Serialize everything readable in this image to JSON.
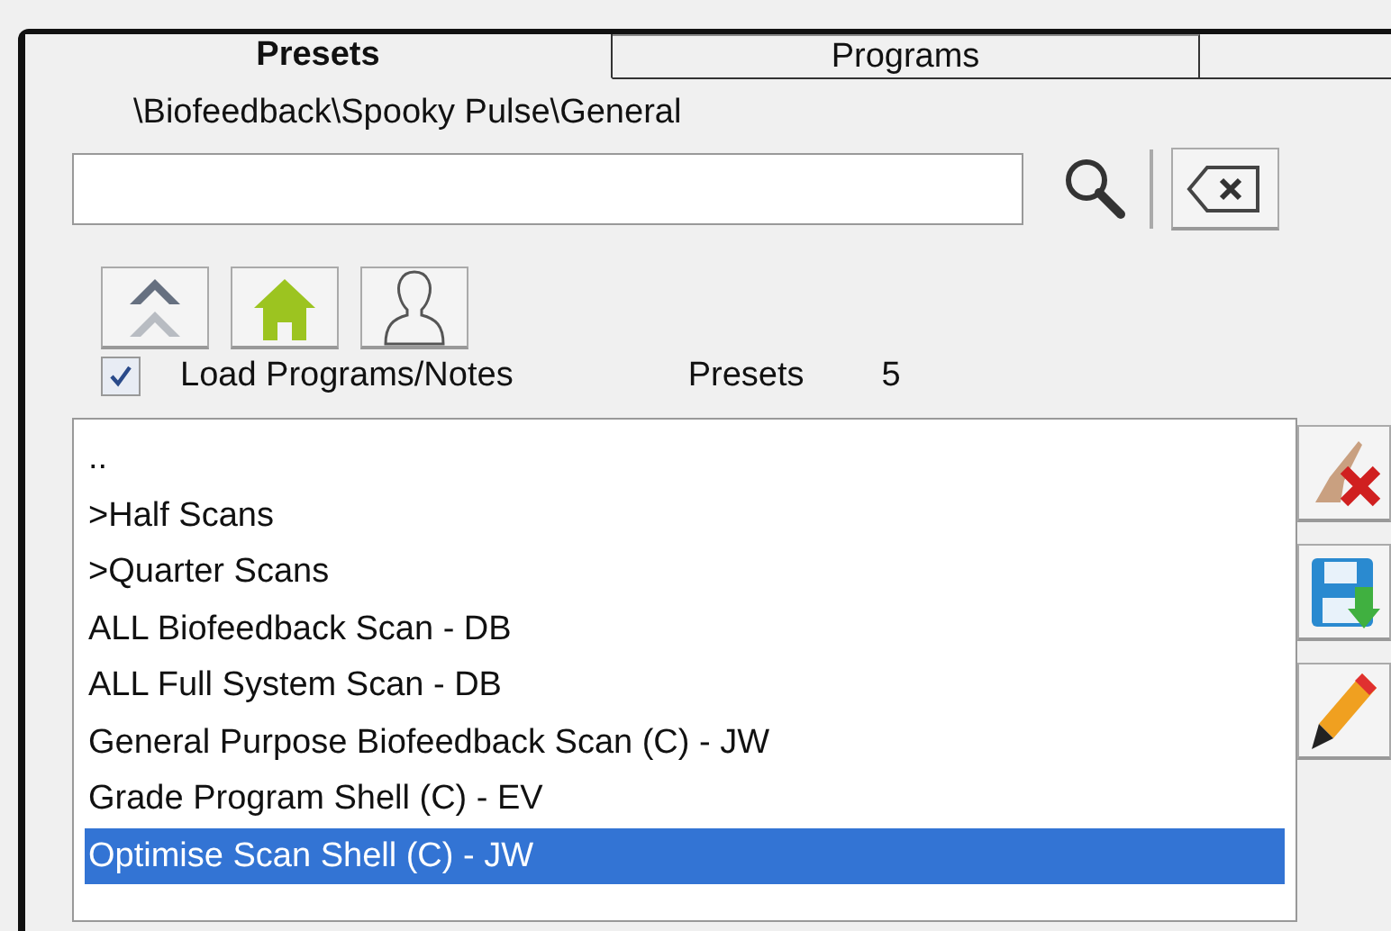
{
  "tabs": [
    {
      "label": "Presets",
      "selected": true
    },
    {
      "label": "Programs",
      "selected": false
    }
  ],
  "path": "\\Biofeedback\\Spooky Pulse\\General",
  "load_programs_notes": {
    "label": "Load Programs/Notes",
    "checked": true
  },
  "presets_label": "Presets",
  "presets_count": "5",
  "list": [
    {
      "text": "..",
      "selected": false
    },
    {
      "text": ">Half Scans",
      "selected": false
    },
    {
      "text": ">Quarter Scans",
      "selected": false
    },
    {
      "text": "ALL Biofeedback Scan - DB",
      "selected": false
    },
    {
      "text": "ALL Full System Scan - DB",
      "selected": false
    },
    {
      "text": "General Purpose Biofeedback Scan (C) - JW",
      "selected": false
    },
    {
      "text": "Grade Program Shell (C) - EV",
      "selected": false
    },
    {
      "text": "Optimise Scan Shell (C) - JW",
      "selected": true
    }
  ]
}
